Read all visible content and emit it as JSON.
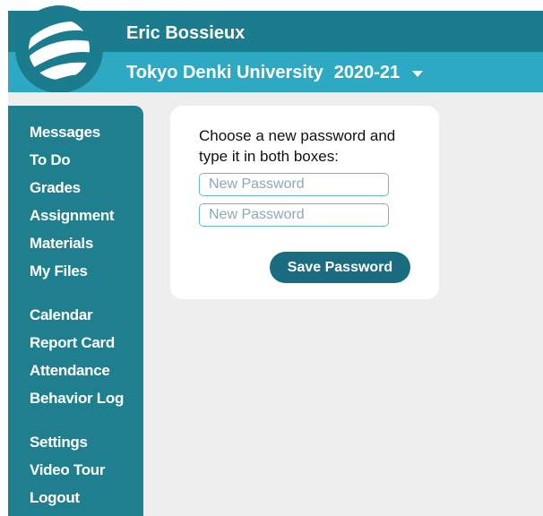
{
  "header": {
    "user_name": "Eric Bossieux",
    "school": "Tokyo Denki University",
    "year": "2020-21",
    "logo_icon": "globe-logo-icon"
  },
  "sidebar": {
    "items": [
      {
        "label": "Messages"
      },
      {
        "label": "To Do"
      },
      {
        "label": "Grades"
      },
      {
        "label": "Assignment"
      },
      {
        "label": "Materials"
      },
      {
        "label": "My Files"
      },
      {
        "label": "Calendar"
      },
      {
        "label": "Report Card"
      },
      {
        "label": "Attendance"
      },
      {
        "label": "Behavior Log"
      },
      {
        "label": "Settings"
      },
      {
        "label": "Video Tour"
      },
      {
        "label": "Logout"
      }
    ]
  },
  "password_form": {
    "prompt": "Choose a new password and type it in both boxes:",
    "new_password_placeholder": "New Password",
    "confirm_password_placeholder": "New Password",
    "save_label": "Save Password"
  },
  "colors": {
    "header_dark": "#1a7c8d",
    "header_light": "#2ea9c3",
    "sidebar": "#1f7f8e",
    "button": "#1a6d80"
  }
}
